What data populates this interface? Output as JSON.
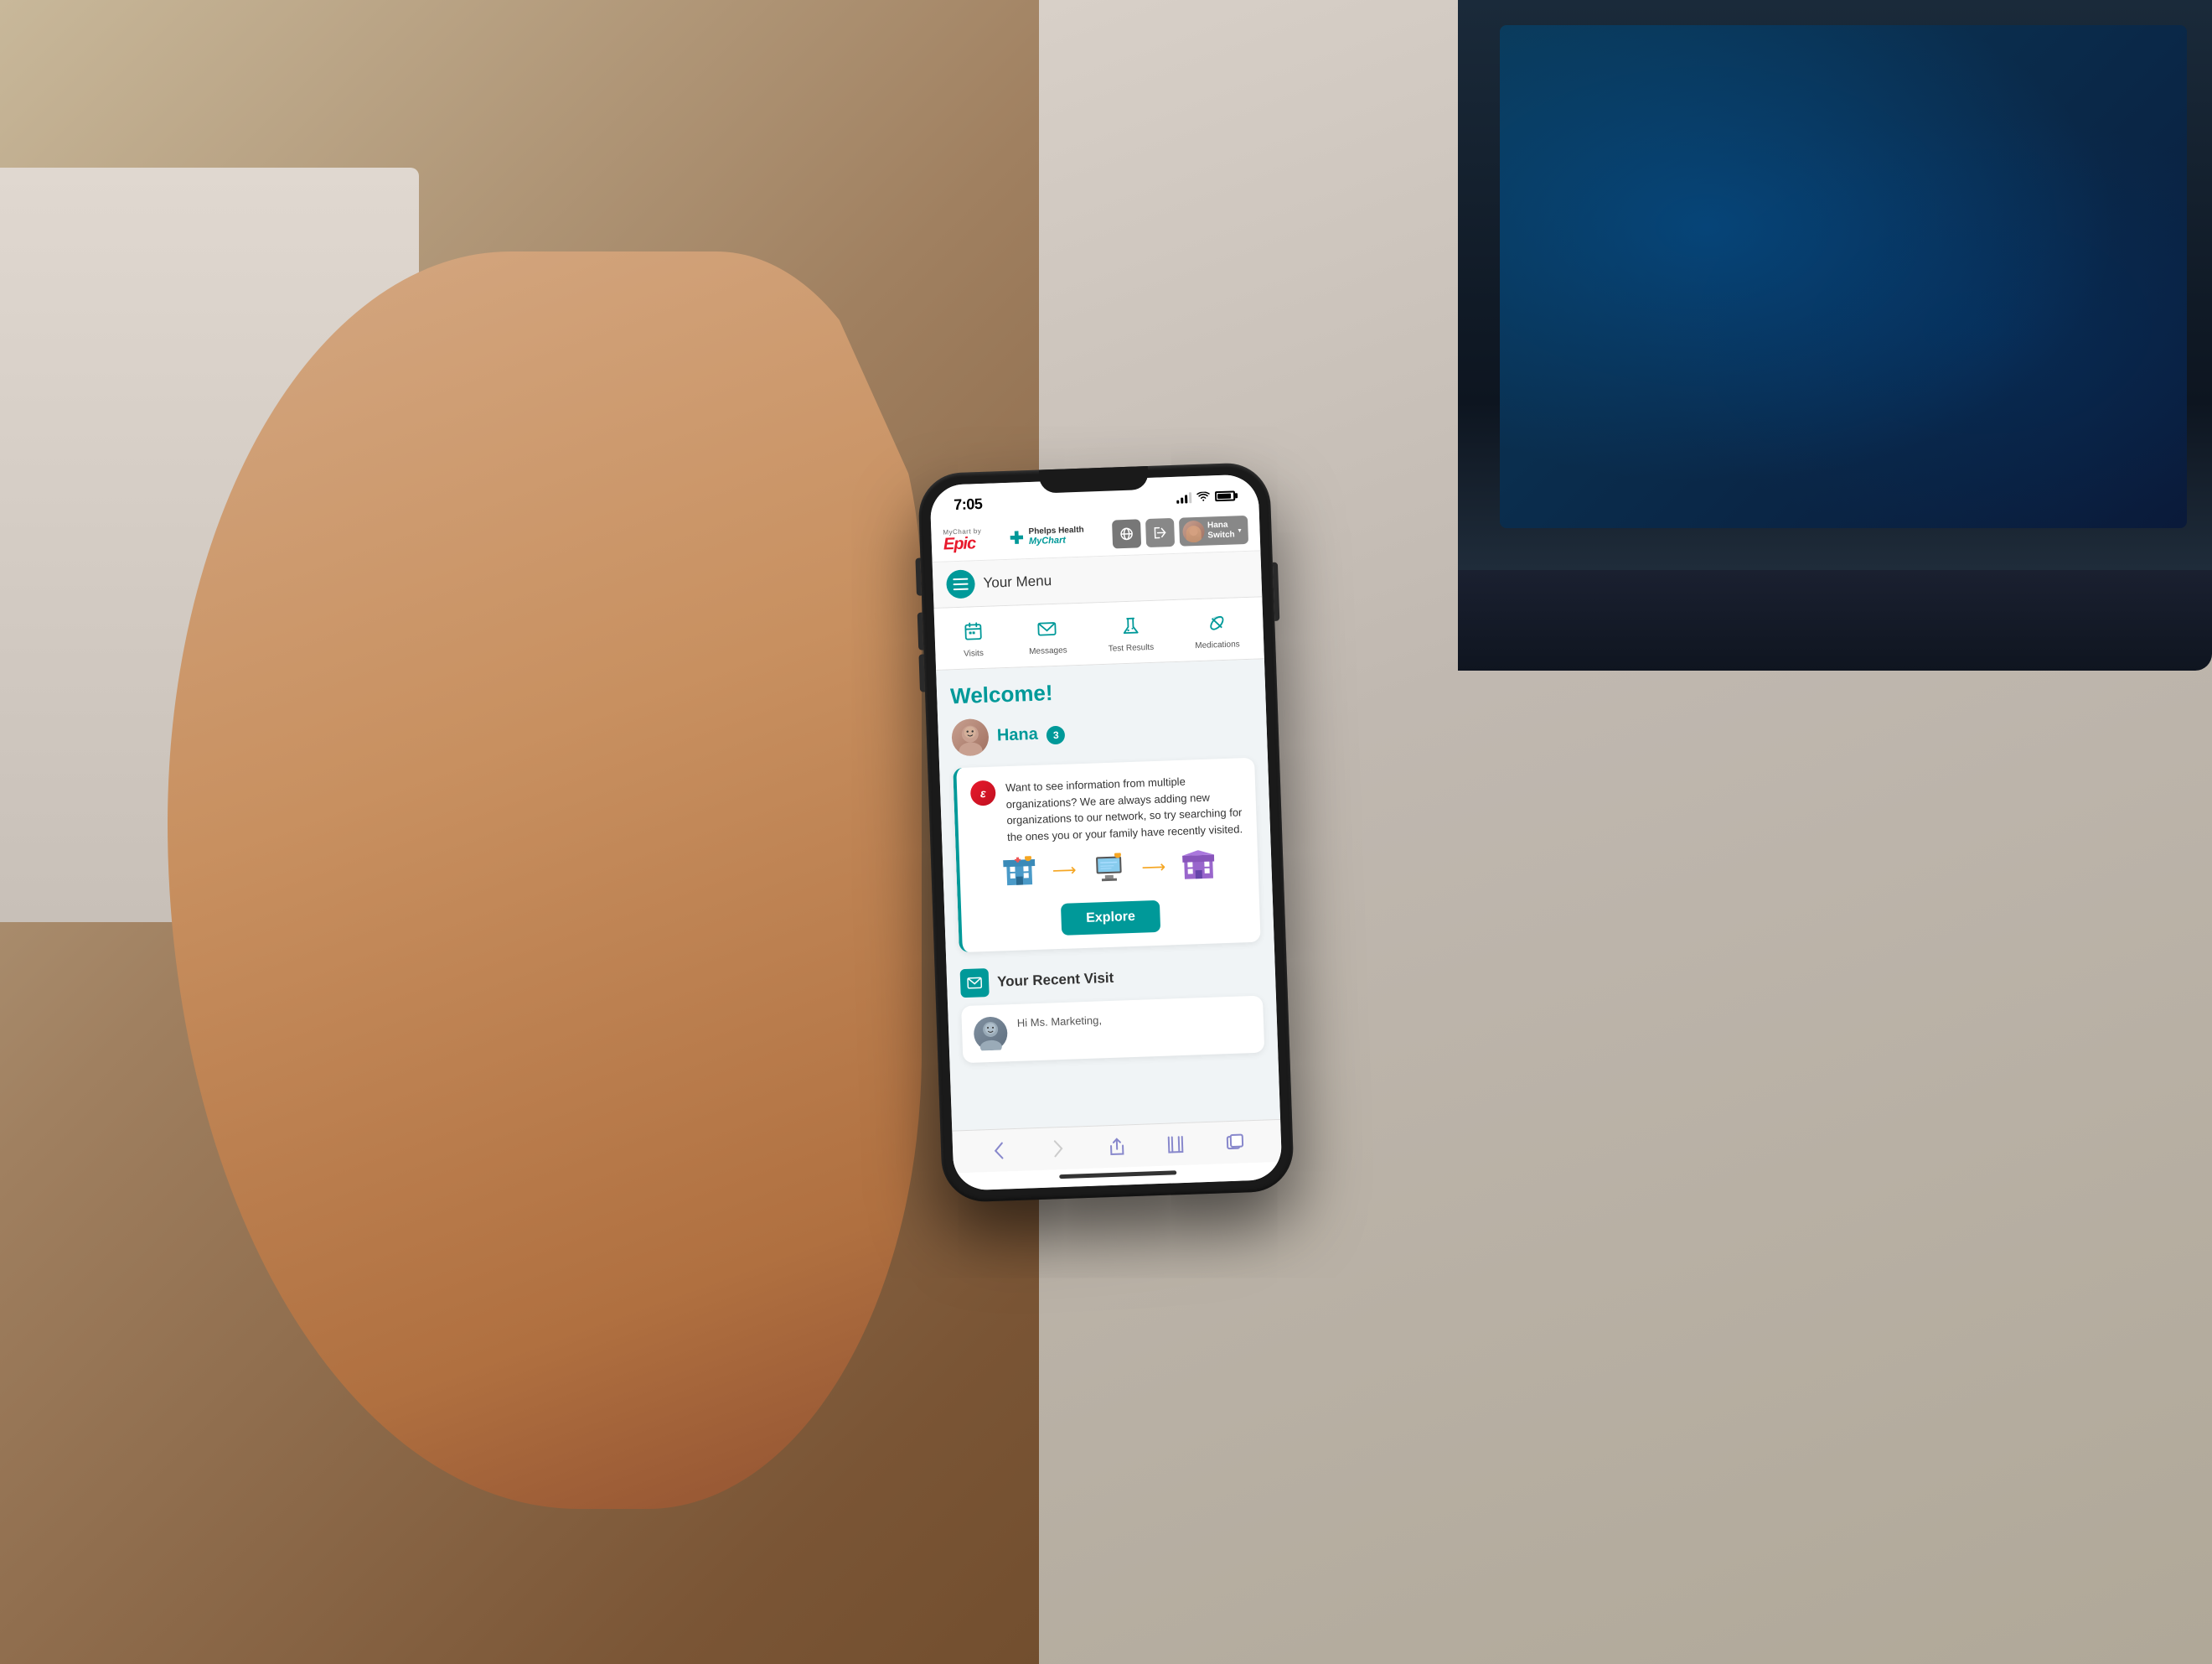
{
  "scene": {
    "background_color": "#7a5535"
  },
  "status_bar": {
    "time": "7:05",
    "signal_strength": "medium",
    "wifi": "on",
    "battery": "full"
  },
  "header": {
    "logo_by_text": "MyChart by",
    "logo_brand": "Epic",
    "hospital_name": "Phelps Health",
    "hospital_sub": "MyChart",
    "globe_icon": "globe-icon",
    "logout_icon": "logout-icon",
    "user_name_line1": "Hana",
    "user_name_line2": "Switch",
    "user_dropdown_icon": "chevron-down-icon"
  },
  "menu_bar": {
    "hamburger_icon": "menu-icon",
    "label": "Your Menu"
  },
  "quick_nav": {
    "items": [
      {
        "id": "visits",
        "label": "Visits",
        "icon": "calendar-icon"
      },
      {
        "id": "messages",
        "label": "Messages",
        "icon": "envelope-icon"
      },
      {
        "id": "test_results",
        "label": "Test Results",
        "icon": "flask-icon"
      },
      {
        "id": "medications",
        "label": "Medications",
        "icon": "pill-icon"
      }
    ]
  },
  "welcome": {
    "title": "Welcome!",
    "user_name": "Hana",
    "notification_count": "3"
  },
  "explore_card": {
    "text": "Want to see information from multiple organizations? We are always adding new organizations to our network, so try searching for the ones you or your family have recently visited.",
    "button_label": "Explore",
    "epic_icon": "epic-e-icon"
  },
  "recent_visit": {
    "section_icon": "envelope-blue-icon",
    "title": "Your Recent Visit",
    "preview_text": "Hi Ms. Marketing,"
  },
  "browser_bar": {
    "back_icon": "browser-back-icon",
    "forward_icon": "browser-forward-icon",
    "share_icon": "browser-share-icon",
    "book_icon": "browser-book-icon",
    "tabs_icon": "browser-tabs-icon"
  }
}
